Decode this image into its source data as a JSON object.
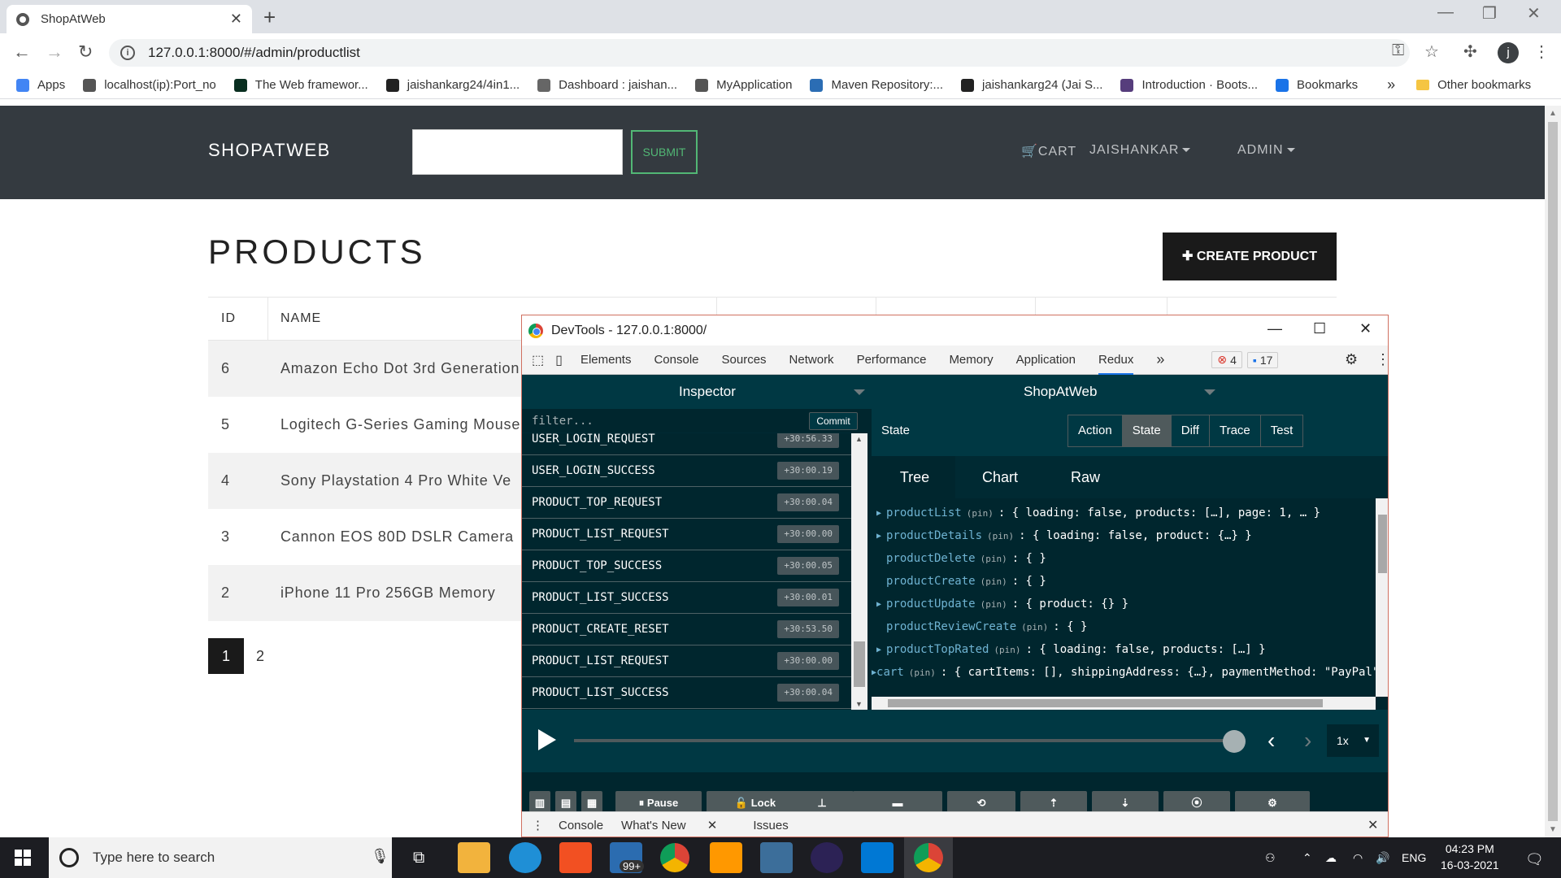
{
  "browser": {
    "tab_title": "ShopAtWeb",
    "url": "127.0.0.1:8000/#/admin/productlist",
    "bookmarks": [
      {
        "label": "Apps",
        "color": "#4285f4"
      },
      {
        "label": "localhost(ip):Port_no",
        "color": "#555"
      },
      {
        "label": "The Web framewor...",
        "color": "#092e20"
      },
      {
        "label": "jaishankarg24/4in1...",
        "color": "#222"
      },
      {
        "label": "Dashboard : jaishan...",
        "color": "#666"
      },
      {
        "label": "MyApplication",
        "color": "#555"
      },
      {
        "label": "Maven Repository:...",
        "color": "#2b6db4"
      },
      {
        "label": "jaishankarg24 (Jai S...",
        "color": "#222"
      },
      {
        "label": "Introduction · Boots...",
        "color": "#563d7c"
      },
      {
        "label": "Bookmarks",
        "color": "#1a73e8"
      }
    ],
    "overflow": "»",
    "other_bookmarks": "Other bookmarks",
    "profile_initial": "j"
  },
  "site": {
    "brand": "SHOPATWEB",
    "submit": "SUBMIT",
    "cart": "CART",
    "user": "JAISHANKAR",
    "admin": "ADMIN",
    "page_title": "PRODUCTS",
    "create_button": "CREATE PRODUCT",
    "table_headers": {
      "id": "ID",
      "name": "NAME"
    },
    "rows": [
      {
        "id": "6",
        "name": "Amazon Echo Dot 3rd Generation"
      },
      {
        "id": "5",
        "name": "Logitech G-Series Gaming Mouse"
      },
      {
        "id": "4",
        "name": "Sony Playstation 4 Pro White Ve"
      },
      {
        "id": "3",
        "name": "Cannon EOS 80D DSLR Camera"
      },
      {
        "id": "2",
        "name": "iPhone 11 Pro 256GB Memory"
      }
    ],
    "pages": [
      "1",
      "2"
    ]
  },
  "devtools": {
    "title": "DevTools - 127.0.0.1:8000/",
    "tabs": [
      "Elements",
      "Console",
      "Sources",
      "Network",
      "Performance",
      "Memory",
      "Application",
      "Redux"
    ],
    "more": "»",
    "errors": "4",
    "messages": "17",
    "inspector": "Inspector",
    "store": "ShopAtWeb",
    "filter_placeholder": "filter...",
    "commit": "Commit",
    "actions": [
      {
        "name": "USER_LOGIN_REQUEST",
        "time": "+30:56.33"
      },
      {
        "name": "USER_LOGIN_SUCCESS",
        "time": "+30:00.19"
      },
      {
        "name": "PRODUCT_TOP_REQUEST",
        "time": "+30:00.04"
      },
      {
        "name": "PRODUCT_LIST_REQUEST",
        "time": "+30:00.00"
      },
      {
        "name": "PRODUCT_TOP_SUCCESS",
        "time": "+30:00.05"
      },
      {
        "name": "PRODUCT_LIST_SUCCESS",
        "time": "+30:00.01"
      },
      {
        "name": "PRODUCT_CREATE_RESET",
        "time": "+30:53.50"
      },
      {
        "name": "PRODUCT_LIST_REQUEST",
        "time": "+30:00.00"
      },
      {
        "name": "PRODUCT_LIST_SUCCESS",
        "time": "+30:00.04"
      }
    ],
    "state_label": "State",
    "monitor_tabs": [
      "Action",
      "State",
      "Diff",
      "Trace",
      "Test"
    ],
    "view_tabs": [
      "Tree",
      "Chart",
      "Raw"
    ],
    "tree": [
      {
        "expand": true,
        "key": "productList",
        "pin": "(pin)",
        "val": ": { loading: false, products: […], page: 1, … }"
      },
      {
        "expand": true,
        "key": "productDetails",
        "pin": "(pin)",
        "val": ": { loading: false, product: {…} }"
      },
      {
        "expand": false,
        "key": "productDelete",
        "pin": "(pin)",
        "val": ": { }"
      },
      {
        "expand": false,
        "key": "productCreate",
        "pin": "(pin)",
        "val": ": { }"
      },
      {
        "expand": true,
        "key": "productUpdate",
        "pin": "(pin)",
        "val": ": { product: {} }"
      },
      {
        "expand": false,
        "key": "productReviewCreate",
        "pin": "(pin)",
        "val": ": { }"
      },
      {
        "expand": true,
        "key": "productTopRated",
        "pin": "(pin)",
        "val": ": { loading: false, products: […] }"
      },
      {
        "expand": true,
        "key": "cart",
        "pin": "(pin)",
        "val": ": { cartItems: [], shippingAddress: {…}, paymentMethod: \"PayPal\""
      }
    ],
    "speed": "1x",
    "pause": "Pause",
    "lock": "Lock",
    "drawer_tabs": [
      "Console",
      "What's New",
      "Issues"
    ]
  },
  "taskbar": {
    "search_placeholder": "Type here to search",
    "badge": "99+",
    "lang": "ENG",
    "time": "04:23 PM",
    "date": "16-03-2021"
  }
}
